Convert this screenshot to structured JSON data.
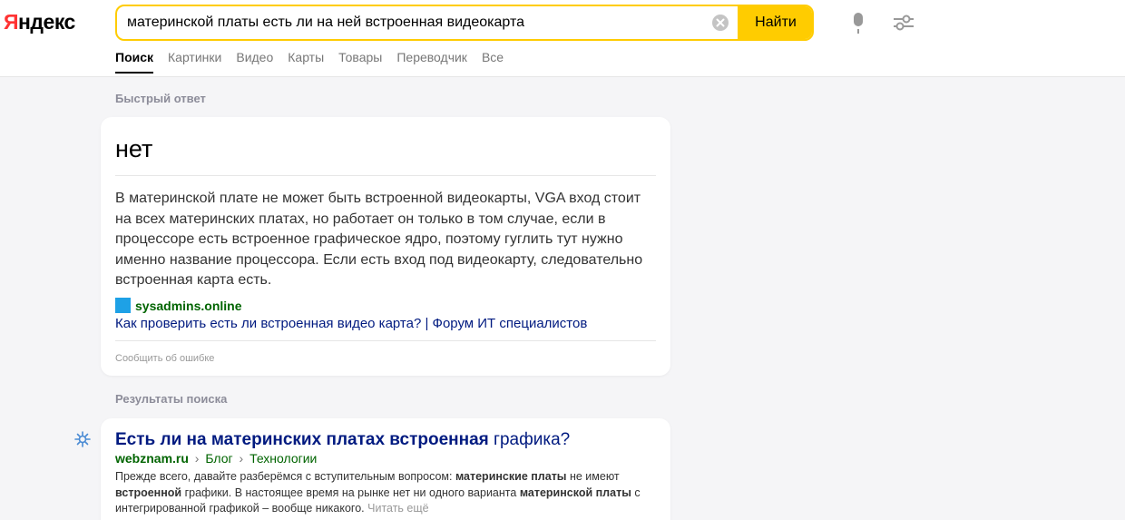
{
  "logo": {
    "first": "Я",
    "rest": "ндекс"
  },
  "search": {
    "query": "материнской платы есть ли на ней встроенная видеокарта",
    "button_label": "Найти"
  },
  "tabs": [
    {
      "label": "Поиск",
      "active": true
    },
    {
      "label": "Картинки"
    },
    {
      "label": "Видео"
    },
    {
      "label": "Карты"
    },
    {
      "label": "Товары"
    },
    {
      "label": "Переводчик"
    },
    {
      "label": "Все"
    }
  ],
  "quick_answer": {
    "section_title": "Быстрый ответ",
    "answer": "нет",
    "text": "В материнской плате не может быть встроенной видеокарты, VGA вход стоит на всех материнских платах, но работает он только в том случае, если в процессоре есть встроенное графическое ядро, поэтому гуглить тут нужно именно название процессора. Если есть вход под видеокарту, следовательно встроенная карта есть.",
    "source_name": "sysadmins.online",
    "source_link": "Как проверить есть ли встроенная видео карта? | Форум ИТ специалистов",
    "report": "Сообщить об ошибке"
  },
  "results": {
    "section_title": "Результаты поиска",
    "items": [
      {
        "title_bold": "Есть ли на материнских платах встроенная",
        "title_rest": " графика?",
        "domain": "webznam.ru",
        "sep1": "›",
        "crumb1": "Блог",
        "sep2": "›",
        "crumb2": "Технологии",
        "snippet": [
          {
            "t": "Прежде всего, давайте разберёмся с вступительным вопросом: "
          },
          {
            "t": "материнские платы",
            "b": true
          },
          {
            "t": " не имеют "
          },
          {
            "t": "встроенной",
            "b": true
          },
          {
            "t": " графики. В настоящее время на рынке нет ни одного варианта "
          },
          {
            "t": "материнской платы",
            "b": true
          },
          {
            "t": " с интегрированной графикой – вообще никакого. "
          }
        ],
        "more": "Читать ещё"
      }
    ]
  },
  "colors": {
    "accent": "#ffcc00",
    "link": "#001a80",
    "url_green": "#006400",
    "logo_red": "#ff3333"
  }
}
